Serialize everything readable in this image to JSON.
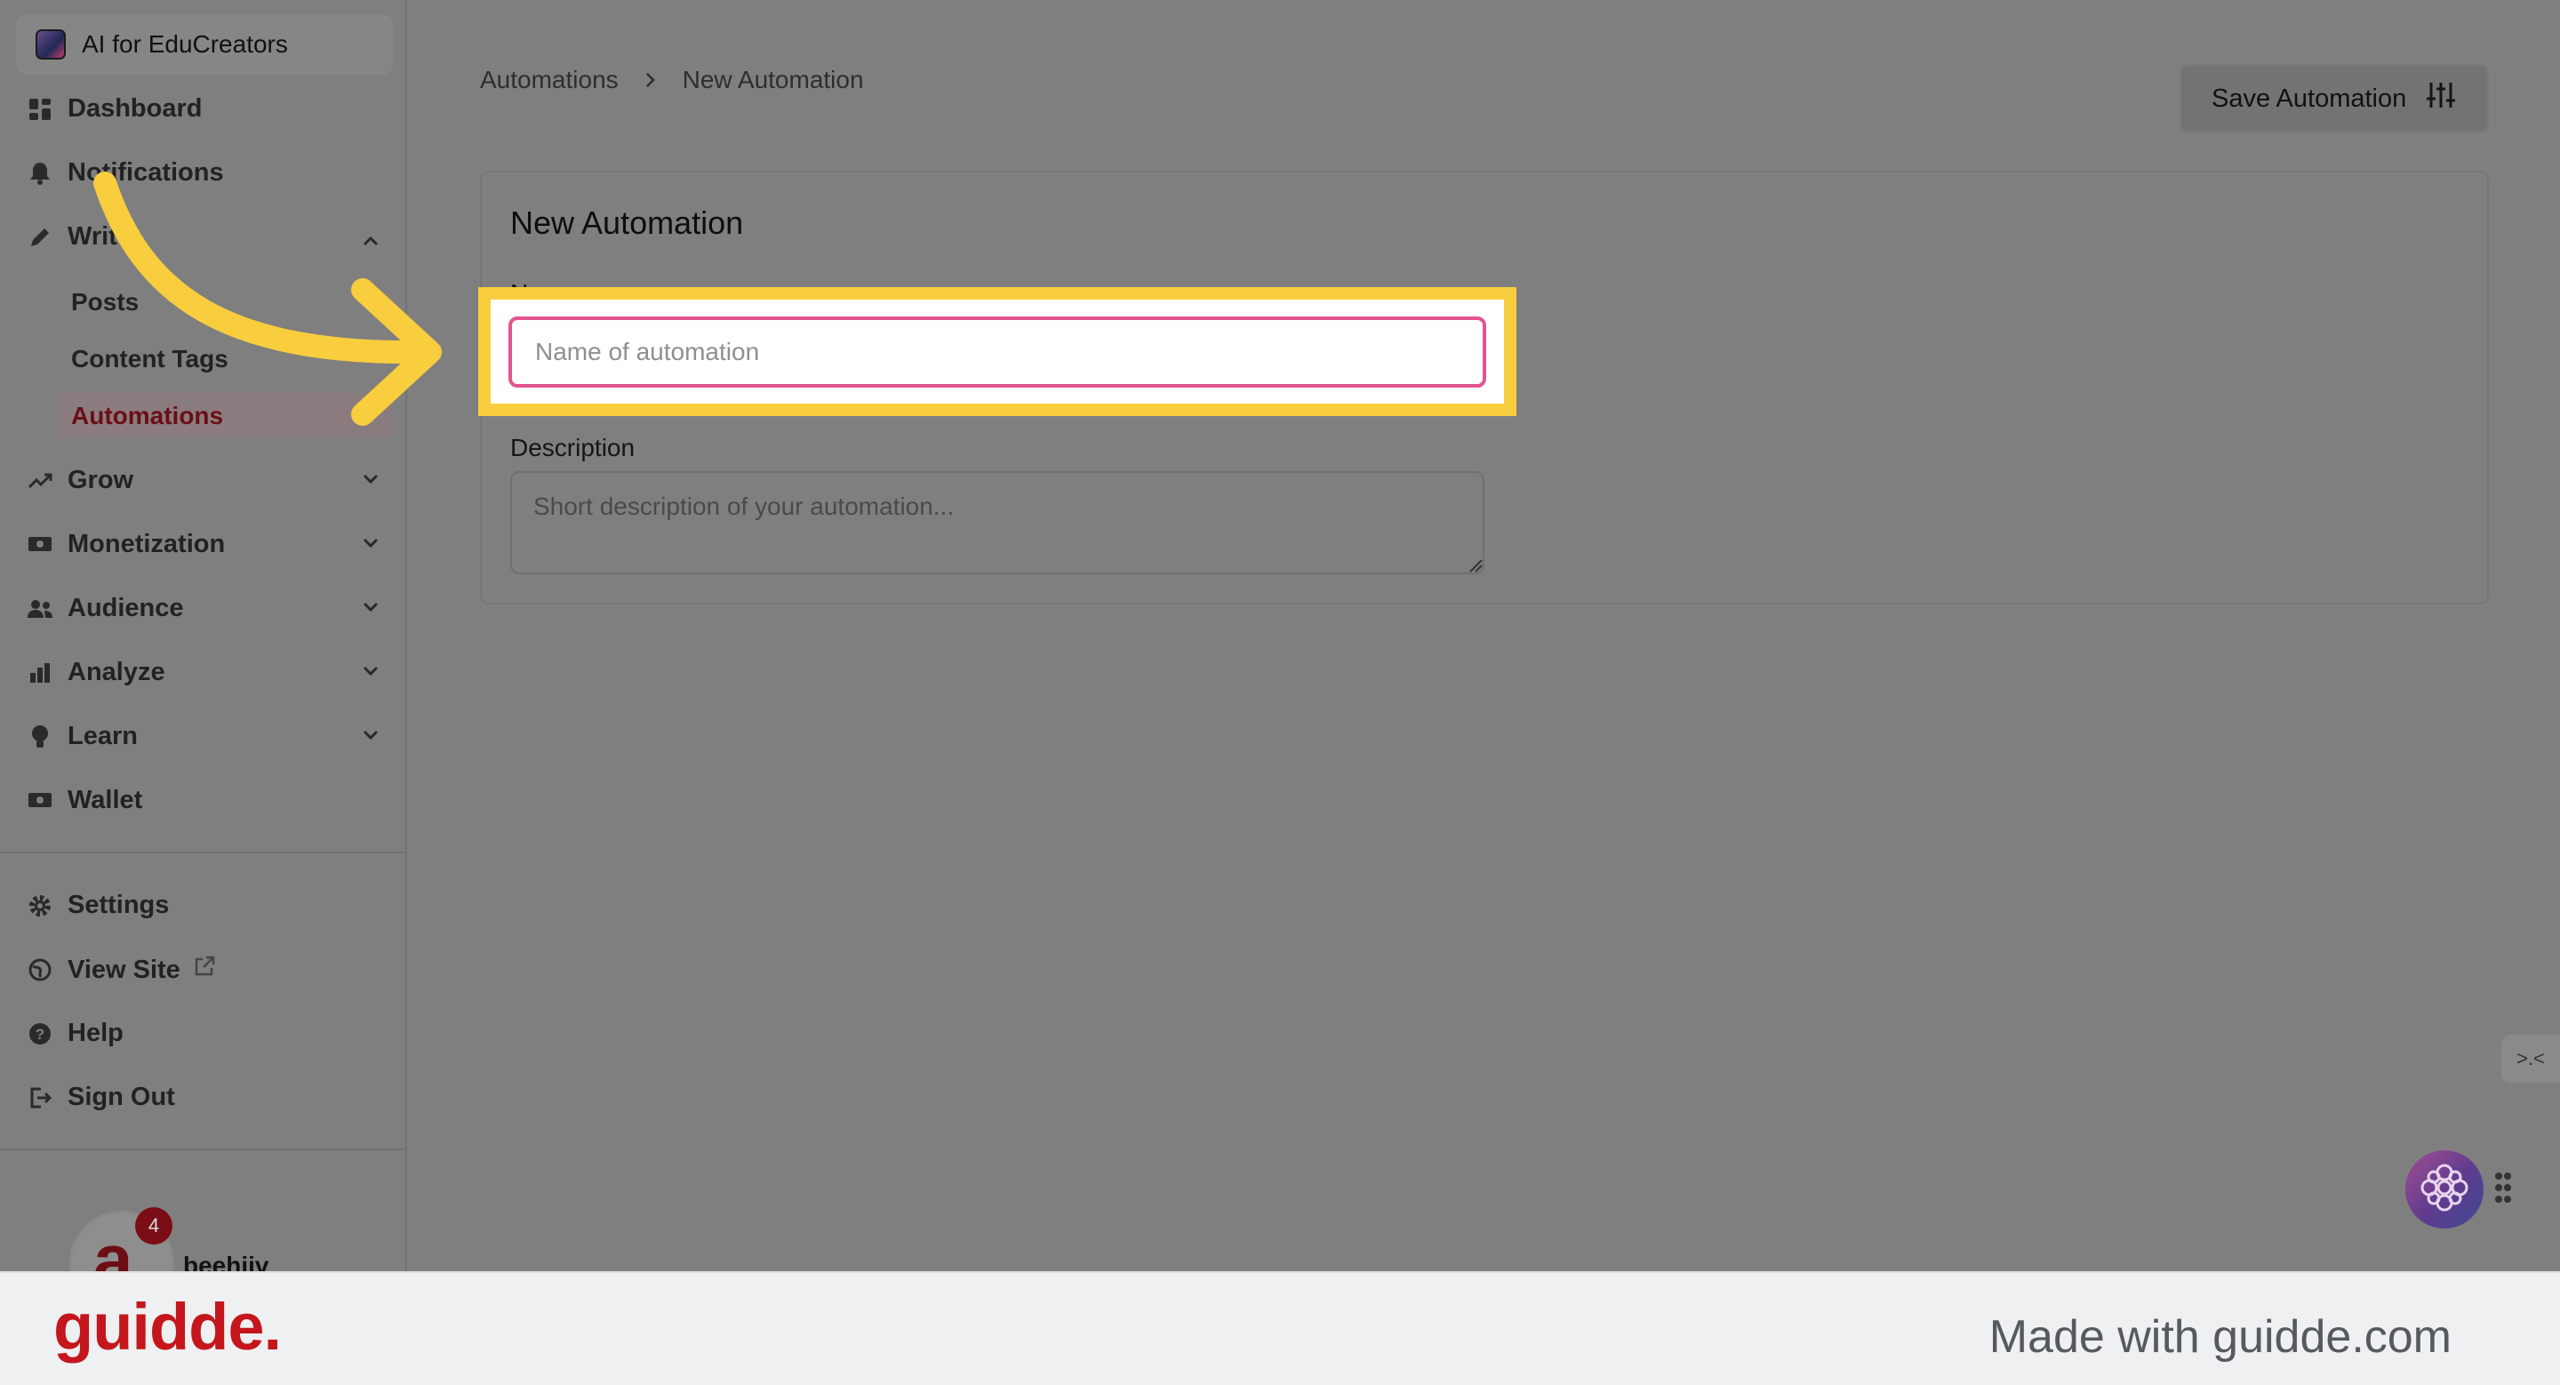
{
  "sidebar": {
    "publication": "AI for EduCreators",
    "nav": [
      {
        "label": "Dashboard",
        "icon": "dashboard-icon"
      },
      {
        "label": "Notifications",
        "icon": "bell-icon"
      },
      {
        "label": "Write",
        "icon": "pencil-icon",
        "expanded": true,
        "children": [
          "Posts",
          "Content Tags",
          "Automations"
        ],
        "active_child": "Automations"
      },
      {
        "label": "Grow",
        "icon": "trending-up-icon"
      },
      {
        "label": "Monetization",
        "icon": "money-icon"
      },
      {
        "label": "Audience",
        "icon": "users-icon"
      },
      {
        "label": "Analyze",
        "icon": "bar-chart-icon"
      },
      {
        "label": "Learn",
        "icon": "lightbulb-icon"
      },
      {
        "label": "Wallet",
        "icon": "wallet-icon"
      }
    ],
    "bottom_nav": [
      {
        "label": "Settings",
        "icon": "gear-icon"
      },
      {
        "label": "View Site",
        "icon": "globe-icon"
      },
      {
        "label": "Help",
        "icon": "help-icon"
      },
      {
        "label": "Sign Out",
        "icon": "sign-out-icon"
      }
    ],
    "account": {
      "name": "beehiiv",
      "avatar_letter": "a",
      "badge": "4"
    }
  },
  "breadcrumb": [
    "Automations",
    "New Automation"
  ],
  "toolbar": {
    "save_label": "Save Automation"
  },
  "form": {
    "title": "New Automation",
    "name_label": "Name",
    "name_placeholder": "Name of automation",
    "description_label": "Description",
    "description_placeholder": "Short description of your automation..."
  },
  "widgets": {
    "side_tab": ">.<"
  },
  "footer": {
    "brand": "guidde.",
    "made_with": "Made with guidde.com"
  },
  "colors": {
    "highlight": "#f8cd3e",
    "input_focus": "#e2548e",
    "brand_red": "#c4161c",
    "active_nav": "#6b0e16"
  }
}
